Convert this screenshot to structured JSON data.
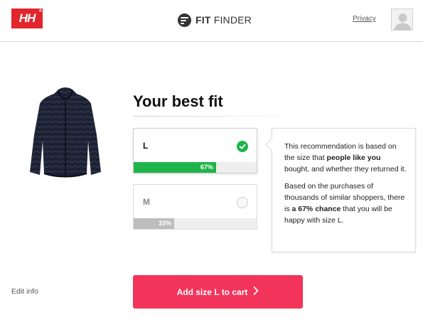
{
  "header": {
    "brand_logo_text": "HH",
    "brand_logo_mark": "®",
    "fit_finder": {
      "bold": "FIT",
      "light": "FINDER"
    },
    "privacy_label": "Privacy",
    "avatar_icon": "user-avatar-icon"
  },
  "colors": {
    "brand_red": "#e2242b",
    "cta": "#f2345a",
    "match_high": "#1fb44a",
    "match_low": "#bdbdbd"
  },
  "title": "Your best fit",
  "sizes": [
    {
      "label": "L",
      "percent_text": "67%",
      "percent": 67,
      "selected": true,
      "icon": "check-circle-icon"
    },
    {
      "label": "M",
      "percent_text": "33%",
      "percent": 33,
      "selected": false,
      "icon": "radio-empty-icon"
    }
  ],
  "explanation": {
    "p1_pre": "This recommendation is based on the size that ",
    "p1_bold": "people like you",
    "p1_post": " bought, and whether they returned it.",
    "p2_pre": "Based on the purchases of thousands of similar shoppers, there is ",
    "p2_bold": "a 67% chance",
    "p2_post": " that you will be happy with size L."
  },
  "footer": {
    "edit_info_label": "Edit info",
    "cta_label": "Add size L to cart",
    "cta_icon": "chevron-right-icon"
  }
}
